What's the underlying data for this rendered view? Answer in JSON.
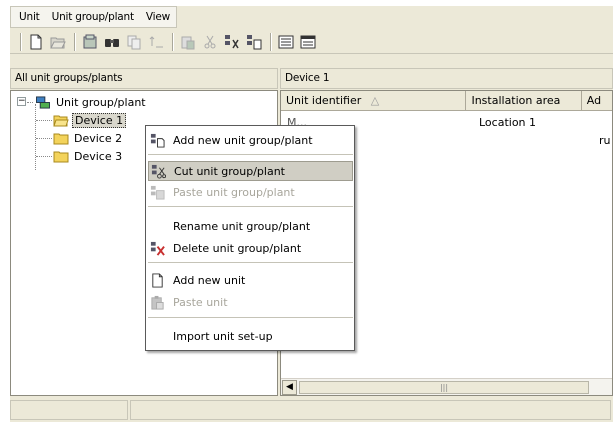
{
  "menubar": {
    "items": [
      "Unit",
      "Unit group/plant",
      "View"
    ]
  },
  "toolbar": {
    "buttons": [
      "new-icon",
      "open-icon",
      "properties-icon",
      "find-icon",
      "copy-icon",
      "sort-icon",
      "paste-icon",
      "cut-icon",
      "cut-unit-group-icon",
      "add-unit-group-icon",
      "list-view-icon",
      "details-view-icon"
    ]
  },
  "left_pane": {
    "header": "All unit groups/plants",
    "tree": {
      "root_label": "Unit group/plant",
      "expander": "−",
      "children": [
        "Device 1",
        "Device 2",
        "Device 3"
      ]
    }
  },
  "right_pane": {
    "header": "Device 1",
    "columns": [
      "Unit identifier",
      "Installation area",
      "Ad"
    ],
    "sort_glyph": "△",
    "rows": [
      {
        "identifier": "M...",
        "installation_area": "Location 1",
        "extra": "ru"
      }
    ]
  },
  "scrollbar": {
    "left_arrow": "◀",
    "grip": "|||"
  },
  "context_menu": {
    "items": [
      {
        "label": "Add new unit group/plant",
        "icon": "add-unit-group-icon",
        "disabled": false,
        "highlighted": false
      },
      {
        "label": "Cut unit group/plant",
        "icon": "cut-unit-group-icon",
        "disabled": false,
        "highlighted": true
      },
      {
        "label": "Paste unit group/plant",
        "icon": "paste-unit-group-icon",
        "disabled": true,
        "highlighted": false
      },
      {
        "label": "Rename unit group/plant",
        "icon": "",
        "disabled": false,
        "highlighted": false
      },
      {
        "label": "Delete unit group/plant",
        "icon": "delete-unit-group-icon",
        "disabled": false,
        "highlighted": false
      },
      {
        "label": "Add new unit",
        "icon": "new-unit-icon",
        "disabled": false,
        "highlighted": false
      },
      {
        "label": "Paste unit",
        "icon": "paste-unit-icon",
        "disabled": true,
        "highlighted": false
      },
      {
        "label": "Import unit set-up",
        "icon": "",
        "disabled": false,
        "highlighted": false
      }
    ]
  },
  "colors": {
    "window_bg": "#ece9d8",
    "menu_highlight": "#d0cec4",
    "disabled_text": "#a8a69c",
    "folder_yellow": "#f3d35b"
  }
}
